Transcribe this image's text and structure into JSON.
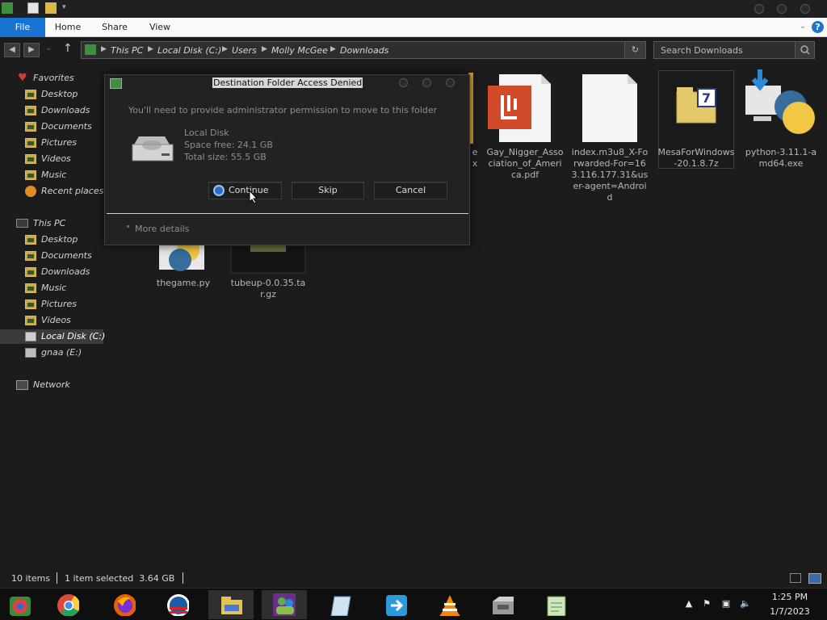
{
  "window": {
    "tabs": [
      "File",
      "Home",
      "Share",
      "View"
    ]
  },
  "address": {
    "crumbs": [
      "This PC",
      "Local Disk (C:)",
      "Users",
      "Molly McGee",
      "Downloads"
    ],
    "search_placeholder": "Search Downloads"
  },
  "sidebar": {
    "favorites_header": "Favorites",
    "favorites": [
      "Desktop",
      "Downloads",
      "Documents",
      "Pictures",
      "Videos",
      "Music",
      "Recent places"
    ],
    "thispc_header": "This PC",
    "thispc": [
      "Desktop",
      "Documents",
      "Downloads",
      "Music",
      "Pictures",
      "Videos",
      "Local Disk (C:)",
      "gnaa (E:)"
    ],
    "network": "Network"
  },
  "files": [
    {
      "name": "e\nx",
      "icon": "partial-icon"
    },
    {
      "name": "Gay_Nigger_Association_of_America.pdf",
      "icon": "pdf-icon"
    },
    {
      "name": "index.m3u8_X-Forwarded-For=163.116.177.31&user-agent=Android",
      "icon": "blank-file-icon"
    },
    {
      "name": "MesaForWindows-20.1.8.7z",
      "icon": "7z-archive-icon"
    },
    {
      "name": "python-3.11.1-amd64.exe",
      "icon": "python-installer-icon"
    },
    {
      "name": "thegame.py",
      "icon": "python-file-icon"
    },
    {
      "name": "tubeup-0.0.35.tar.gz",
      "icon": "archive-icon"
    }
  ],
  "dialog": {
    "title": "Destination Folder Access Denied",
    "message": "You'll need to provide administrator permission to move to this folder",
    "drive_name": "Local Disk",
    "space_free": "Space free: 24.1 GB",
    "total_size": "Total size: 55.5 GB",
    "continue_label": "Continue",
    "skip_label": "Skip",
    "cancel_label": "Cancel",
    "more_details": "More details"
  },
  "status": {
    "items": "10 items",
    "selected": "1 item selected  3.64 GB"
  },
  "taskbar": {
    "apps": [
      "chrome-remote-icon",
      "chrome-icon",
      "firefox-icon",
      "obama-logo-icon",
      "file-explorer-icon",
      "messenger-icon",
      "notes-icon",
      "share-icon",
      "vlc-icon",
      "package-icon",
      "notepad-icon"
    ],
    "time": "1:25 PM",
    "date": "1/7/2023"
  },
  "colors": {
    "accent": "#1874d2",
    "background": "#1c1c1c"
  }
}
